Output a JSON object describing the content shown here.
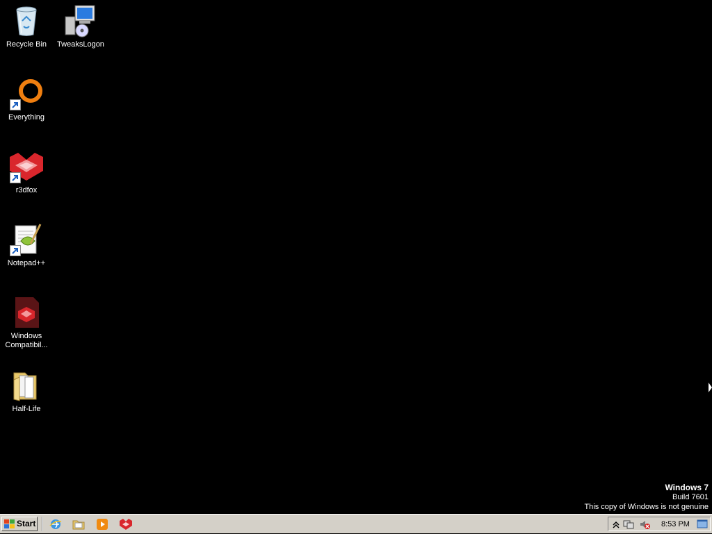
{
  "desktop": {
    "icons": [
      {
        "label": "Recycle Bin",
        "icon": "recycle-bin-icon"
      },
      {
        "label": "TweaksLogon",
        "icon": "tweakslogon-icon"
      },
      {
        "label": "Everything",
        "icon": "everything-icon"
      },
      {
        "label": "r3dfox",
        "icon": "r3dfox-icon"
      },
      {
        "label": "Notepad++",
        "icon": "notepadpp-icon"
      },
      {
        "label": "Windows Compatibil...",
        "icon": "compat-icon"
      },
      {
        "label": "Half-Life",
        "icon": "folder-icon"
      }
    ]
  },
  "watermark": {
    "title": "Windows 7",
    "build": "Build 7601",
    "notice": "This copy of Windows is not genuine"
  },
  "taskbar": {
    "start_label": "Start",
    "quick_launch": [
      "ie-icon",
      "explorer-icon",
      "media-player-icon",
      "r3dfox-icon"
    ],
    "tray": {
      "icons": [
        "show-hidden-chevron-icon",
        "network-icon",
        "volume-muted-icon"
      ],
      "clock": "8:53 PM",
      "show_desktop_icon": "show-desktop-icon"
    }
  },
  "colors": {
    "desktop_bg": "#000000",
    "taskbar_bg": "#d4d0c8",
    "label_text": "#ffffff"
  }
}
